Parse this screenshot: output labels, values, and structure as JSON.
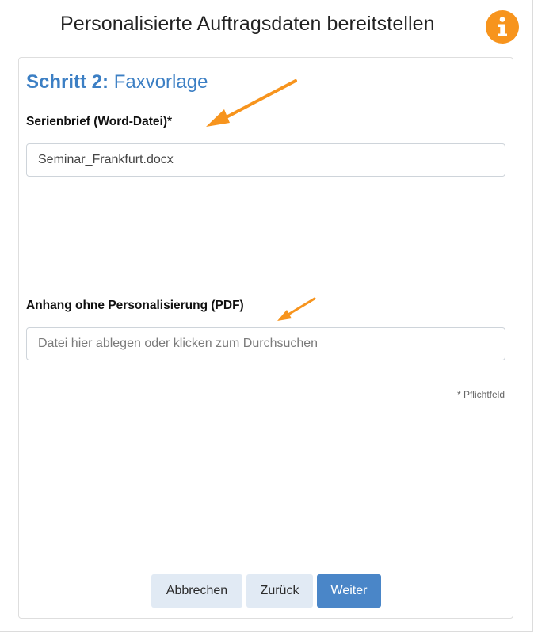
{
  "header": {
    "title": "Personalisierte Auftragsdaten bereitstellen",
    "info_icon": "info-icon",
    "info_color": "#f7941d"
  },
  "step": {
    "prefix": "Schritt 2:",
    "name": "Faxvorlage",
    "color": "#3c7fc4"
  },
  "serienbrief": {
    "label": "Serienbrief (Word-Datei)*",
    "value": "Seminar_Frankfurt.docx"
  },
  "anhang": {
    "label": "Anhang ohne Personalisierung (PDF)",
    "placeholder": "Datei hier ablegen oder klicken zum Durchsuchen"
  },
  "required_note": "* Pflichtfeld",
  "buttons": {
    "cancel": "Abbrechen",
    "back": "Zurück",
    "next": "Weiter"
  },
  "annotation_color": "#f7941d"
}
